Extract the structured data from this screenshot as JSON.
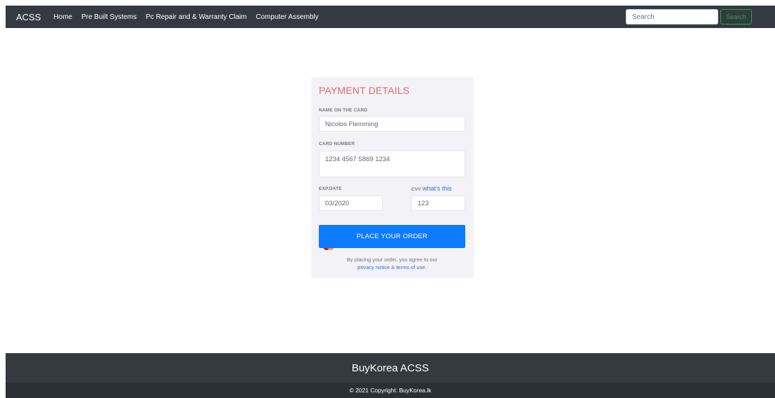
{
  "navbar": {
    "brand": "ACSS",
    "links": [
      "Home",
      "Pre Built Systems",
      "Pc Repair and & Warranty Claim",
      "Computer Assembly"
    ],
    "search_placeholder": "Search",
    "search_button": "Search"
  },
  "payment": {
    "title": "PAYMENT DETAILS",
    "name_label": "NAME ON THE CARD",
    "name_value": "Nicolos Flemming",
    "card_label": "CARD NUMBER",
    "card_value": "1234 4567 5869 1234",
    "card_icon": "mastercard-icon",
    "exp_label": "EXP.DATE",
    "exp_value": "03/2020",
    "cvv_label": "CVV",
    "cvv_link": "what's this",
    "cvv_value": "123",
    "order_button": "PLACE YOUR ORDER",
    "terms_prefix": "By placing your order, you agree to our",
    "privacy_link": "privacy notice",
    "terms_joiner": "&",
    "terms_link": "terms of use",
    "terms_suffix": "."
  },
  "footer": {
    "title": "BuyKorea ACSS",
    "copyright": "© 2021 Copyright: BuyKorea.lk"
  },
  "colors": {
    "navbar": "#343a40",
    "accent_title": "#e56865",
    "primary_button": "#0d7bff",
    "search_button": "#28a745",
    "card_background": "#f2f2f7"
  }
}
